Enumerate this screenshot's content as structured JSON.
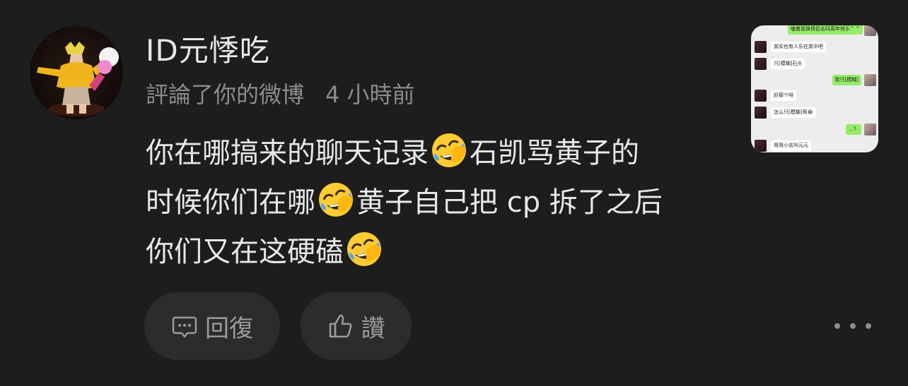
{
  "comment": {
    "username": "ID元悸吃",
    "action_text": "評論了你的微博",
    "time": "4 小時前",
    "content_lines": [
      [
        "你在哪搞来的聊天记录",
        "石凯骂黄子的"
      ],
      [
        "时候你们在哪",
        "黄子自己把 cp 拆了之后"
      ],
      [
        "你们又在这硬磕",
        ""
      ]
    ],
    "emoji_icon": "rolling-on-floor-laughing-emoji"
  },
  "thumbnail": {
    "messages": [
      {
        "side": "right",
        "text": "嗑着我换情侣名四周年快乐^ ^"
      },
      {
        "side": "left",
        "text": "其实也有人乐在其中吧"
      },
      {
        "side": "left",
        "text": "只[模糊]石头"
      },
      {
        "side": "right",
        "text": "我只[模糊]"
      },
      {
        "side": "left",
        "text": "好那个呀"
      },
      {
        "side": "left",
        "text": "怎么只[模糊]哥😂"
      },
      {
        "side": "right",
        "text": "...？"
      },
      {
        "side": "left",
        "text": "哥哥小名叫元元"
      }
    ]
  },
  "actions": {
    "reply_label": "回復",
    "like_label": "讚"
  },
  "icons": {
    "reply": "comment-bubble-icon",
    "like": "thumbs-up-icon",
    "more": "more-dots-icon"
  },
  "colors": {
    "background": "#1d1d1d",
    "button_bg": "#2c2c2c",
    "muted_text": "#8c8c8c",
    "wechat_green": "#95ec69"
  }
}
